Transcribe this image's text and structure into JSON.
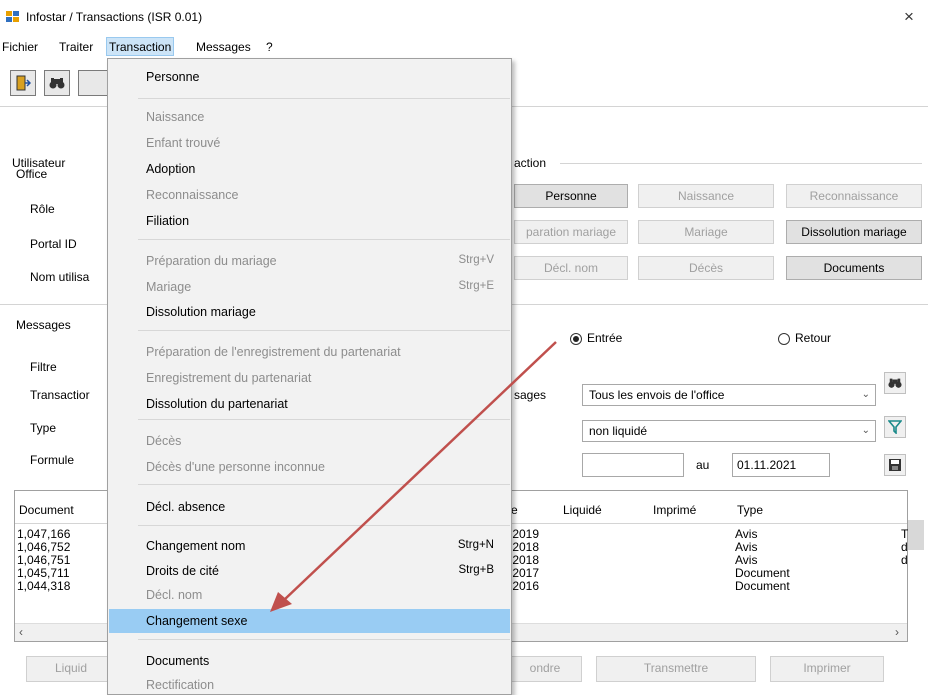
{
  "window": {
    "title": "Infostar / Transactions (ISR 0.01)",
    "close": "×"
  },
  "menubar": {
    "items": [
      "Fichier",
      "Traiter",
      "Transaction",
      "Messages",
      "?"
    ]
  },
  "toolbar": {
    "icons": [
      "door-exit-icon",
      "binoculars-icon"
    ]
  },
  "user_panel": {
    "group": "Utilisateur",
    "labels": [
      "Office",
      "Rôle",
      "Portal ID",
      "Nom utilisa"
    ]
  },
  "transaction_panel": {
    "group": "action",
    "buttons": [
      {
        "label": "Personne",
        "enabled": true
      },
      {
        "label": "Naissance",
        "enabled": false
      },
      {
        "label": "Reconnaissance",
        "enabled": false
      },
      {
        "label": "paration mariage",
        "enabled": false
      },
      {
        "label": "Mariage",
        "enabled": false
      },
      {
        "label": "Dissolution mariage",
        "enabled": true
      },
      {
        "label": "Décl. nom",
        "enabled": false
      },
      {
        "label": "Décès",
        "enabled": false
      },
      {
        "label": "Documents",
        "enabled": true
      }
    ]
  },
  "messages_panel": {
    "group": "Messages",
    "radio_entree": "Entrée",
    "radio_retour": "Retour",
    "filter_group": "Filtre",
    "labels": [
      "Transactior",
      "Type",
      "Formule"
    ],
    "sages_label": "sages",
    "select_envois": "Tous les envois de l'office",
    "select_etat": "non liquidé",
    "date_from": "",
    "au_label": "au",
    "date_to": "01.11.2021"
  },
  "table": {
    "headers": [
      "Document",
      "e",
      "Liquidé",
      "Imprimé",
      "Type"
    ],
    "rows": [
      {
        "document": "1,047,166",
        "date": ".2019",
        "type": "Avis",
        "extra": "T"
      },
      {
        "document": "1,046,752",
        "date": ".2018",
        "type": "Avis",
        "extra": "d"
      },
      {
        "document": "1,046,751",
        "date": ".2018",
        "type": "Avis",
        "extra": "d"
      },
      {
        "document": "1,045,711",
        "date": ".2017",
        "type": "Document",
        "extra": ""
      },
      {
        "document": "1,044,318",
        "date": ".2016",
        "type": "Document",
        "extra": ""
      }
    ]
  },
  "bottom_buttons": [
    "Liquid",
    "ondre",
    "Transmettre",
    "Imprimer"
  ],
  "dropdown": {
    "items": [
      {
        "label": "Personne",
        "enabled": true,
        "shortcut": ""
      },
      {
        "label": "Naissance",
        "enabled": false,
        "shortcut": ""
      },
      {
        "label": "Enfant trouvé",
        "enabled": false,
        "shortcut": ""
      },
      {
        "label": "Adoption",
        "enabled": true,
        "shortcut": ""
      },
      {
        "label": "Reconnaissance",
        "enabled": false,
        "shortcut": ""
      },
      {
        "label": "Filiation",
        "enabled": true,
        "shortcut": ""
      },
      {
        "label": "Préparation du mariage",
        "enabled": false,
        "shortcut": "Strg+V"
      },
      {
        "label": "Mariage",
        "enabled": false,
        "shortcut": "Strg+E"
      },
      {
        "label": "Dissolution mariage",
        "enabled": true,
        "shortcut": ""
      },
      {
        "label": "Préparation de l'enregistrement du partenariat",
        "enabled": false,
        "shortcut": ""
      },
      {
        "label": "Enregistrement du partenariat",
        "enabled": false,
        "shortcut": ""
      },
      {
        "label": "Dissolution du partenariat",
        "enabled": true,
        "shortcut": ""
      },
      {
        "label": "Décès",
        "enabled": false,
        "shortcut": ""
      },
      {
        "label": "Décès d'une personne inconnue",
        "enabled": false,
        "shortcut": ""
      },
      {
        "label": "Décl. absence",
        "enabled": true,
        "shortcut": ""
      },
      {
        "label": "Changement nom",
        "enabled": true,
        "shortcut": "Strg+N"
      },
      {
        "label": "Droits de cité",
        "enabled": true,
        "shortcut": "Strg+B"
      },
      {
        "label": "Décl. nom",
        "enabled": false,
        "shortcut": ""
      },
      {
        "label": "Changement sexe",
        "enabled": true,
        "shortcut": "",
        "highlighted": true
      },
      {
        "label": "Documents",
        "enabled": true,
        "shortcut": ""
      },
      {
        "label": "Rectification",
        "enabled": false,
        "shortcut": ""
      }
    ]
  },
  "annotation": {
    "arrow_color": "#c0504d"
  }
}
